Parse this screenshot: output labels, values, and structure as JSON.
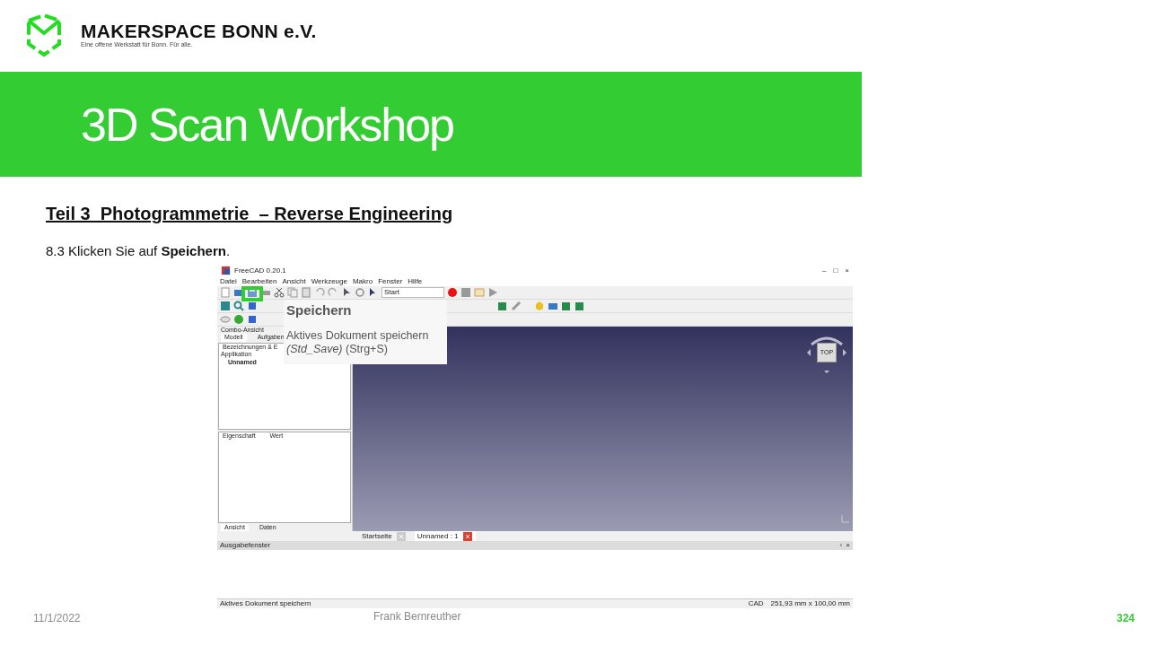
{
  "logo": {
    "name": "MAKERSPACE BONN e.V.",
    "tagline": "Eine offene Werkstatt für Bonn. Für alle."
  },
  "slide_title": "3D Scan Workshop",
  "section_heading": "Teil 3  Photogrammetrie  – Reverse Engineering",
  "instruction": "8.3 Klicken Sie auf **Speichern**.",
  "screenshot": {
    "title": "FreeCAD 0.20.1",
    "window_controls": [
      "–",
      "□",
      "×"
    ],
    "menus": [
      "Datei",
      "Bearbeiten",
      "Ansicht",
      "Werkzeuge",
      "Makro",
      "Fenster",
      "Hilfe"
    ],
    "workbench": "Start",
    "combo_title": "Combo-Ansicht",
    "combo_tabs": [
      {
        "label": "Modell",
        "selected": true
      },
      {
        "label": "Aufgaben",
        "selected": false
      }
    ],
    "tree_header": "Bezeichnungen & E",
    "tree": [
      {
        "label": "Applikation",
        "children": [
          {
            "label": "Unnamed"
          }
        ]
      }
    ],
    "property_columns": [
      "Eigenschaft",
      "Wert"
    ],
    "bottom_tabs": [
      {
        "label": "Ansicht",
        "selected": true
      },
      {
        "label": "Daten",
        "selected": false
      }
    ],
    "navcube_label": "TOP",
    "doc_tabs": [
      {
        "label": "Startseite",
        "selected": false
      },
      {
        "label": "Unnamed : 1",
        "selected": true
      }
    ],
    "output_title": "Ausgabefenster",
    "output_controls": [
      "▫",
      "×"
    ],
    "status_text": "Aktives Dokument speichern",
    "status_nav": "CAD",
    "status_dims": "251,93 mm x 100,00 mm",
    "tooltip": {
      "title": "Speichern",
      "description": "Aktives Dokument speichern",
      "command": "*(Std_Save)* (Strg+S)"
    }
  },
  "footer": {
    "date": "11/1/2022",
    "author": "Frank Bernreuther",
    "page": "324"
  }
}
